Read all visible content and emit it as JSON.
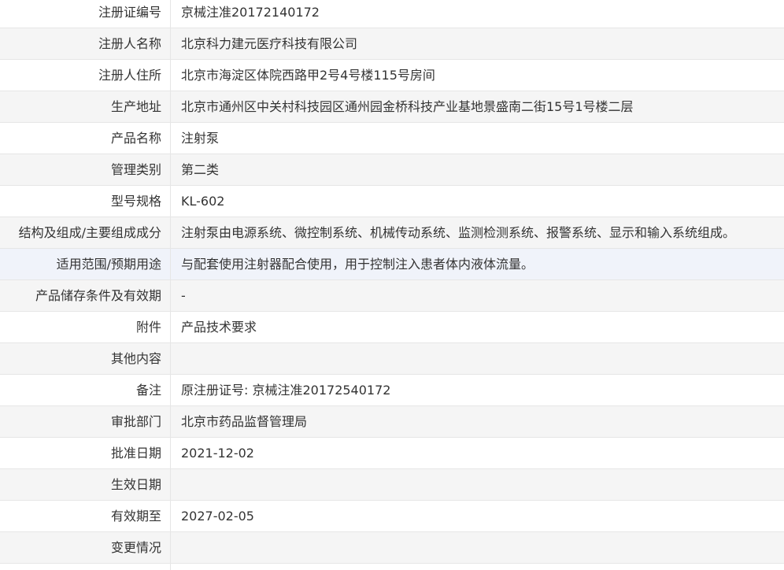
{
  "record": {
    "rows": [
      {
        "label": "注册证编号",
        "value": "京械注准20172140172"
      },
      {
        "label": "注册人名称",
        "value": "北京科力建元医疗科技有限公司"
      },
      {
        "label": "注册人住所",
        "value": "北京市海淀区体院西路甲2号4号楼115号房间"
      },
      {
        "label": "生产地址",
        "value": "北京市通州区中关村科技园区通州园金桥科技产业基地景盛南二街15号1号楼二层"
      },
      {
        "label": "产品名称",
        "value": "注射泵"
      },
      {
        "label": "管理类别",
        "value": "第二类"
      },
      {
        "label": "型号规格",
        "value": "KL-602"
      },
      {
        "label": "结构及组成/主要组成成分",
        "value": "注射泵由电源系统、微控制系统、机械传动系统、监测检测系统、报警系统、显示和输入系统组成。"
      },
      {
        "label": "适用范围/预期用途",
        "value": "与配套使用注射器配合使用，用于控制注入患者体内液体流量。"
      },
      {
        "label": "产品储存条件及有效期",
        "value": "-"
      },
      {
        "label": "附件",
        "value": "产品技术要求"
      },
      {
        "label": "其他内容",
        "value": ""
      },
      {
        "label": "备注",
        "value": "原注册证号: 京械注准20172540172"
      },
      {
        "label": "审批部门",
        "value": "北京市药品监督管理局"
      },
      {
        "label": "批准日期",
        "value": "2021-12-02"
      },
      {
        "label": "生效日期",
        "value": ""
      },
      {
        "label": "有效期至",
        "value": "2027-02-05"
      },
      {
        "label": "变更情况",
        "value": ""
      }
    ]
  }
}
